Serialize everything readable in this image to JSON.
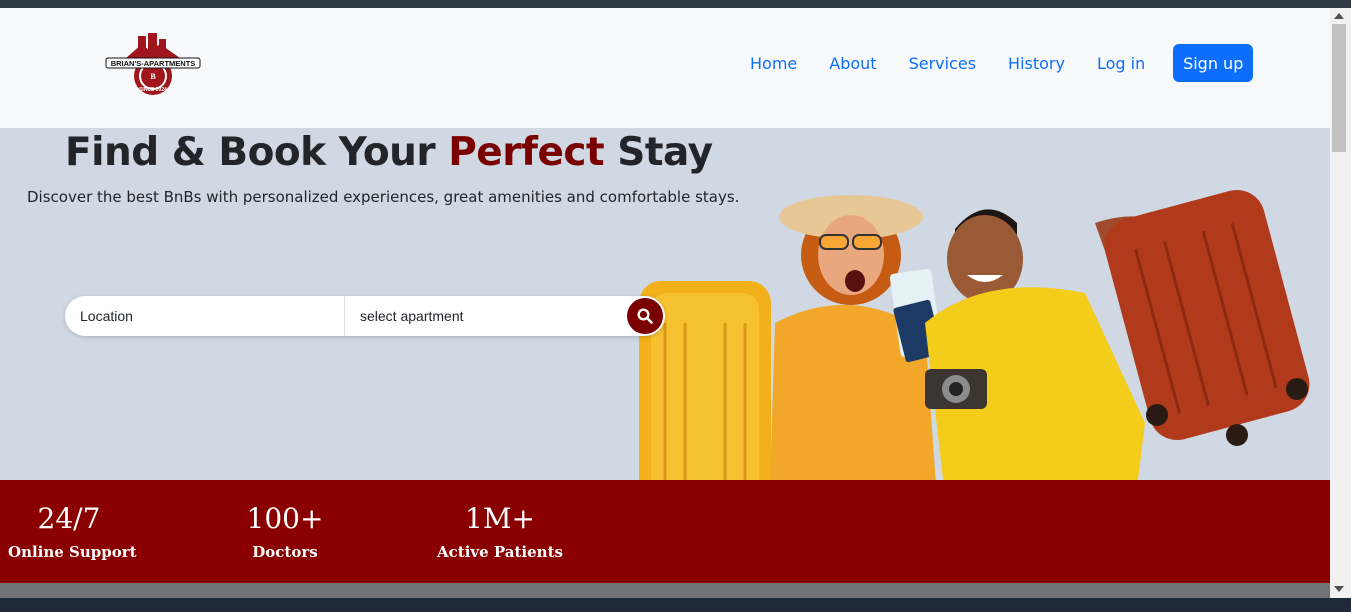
{
  "brand": {
    "name": "BRIAN'S-APARTMENTS",
    "tagline": "SINCE 2024",
    "monogram": "B"
  },
  "nav": {
    "links": [
      "Home",
      "About",
      "Services",
      "History",
      "Log in"
    ],
    "signup_label": "Sign up"
  },
  "hero": {
    "title_part1": "Find & Book Your ",
    "title_accent": "Perfect",
    "title_part2": " Stay",
    "subtitle": "Discover the best BnBs with personalized experiences, great amenities and comfortable stays."
  },
  "search": {
    "location_label": "Location",
    "apartment_label": "select apartment",
    "button_icon": "search-icon"
  },
  "stats": [
    {
      "value": "24/7",
      "label": "Online Support"
    },
    {
      "value": "100+",
      "label": "Doctors"
    },
    {
      "value": "1M+",
      "label": "Active Patients"
    }
  ],
  "colors": {
    "brand_red": "#8a0000",
    "accent_red": "#7a0000",
    "primary_blue": "#0d6efd",
    "hero_bg": "#cfd8e3",
    "navbar_bg": "#f8f9fa"
  }
}
